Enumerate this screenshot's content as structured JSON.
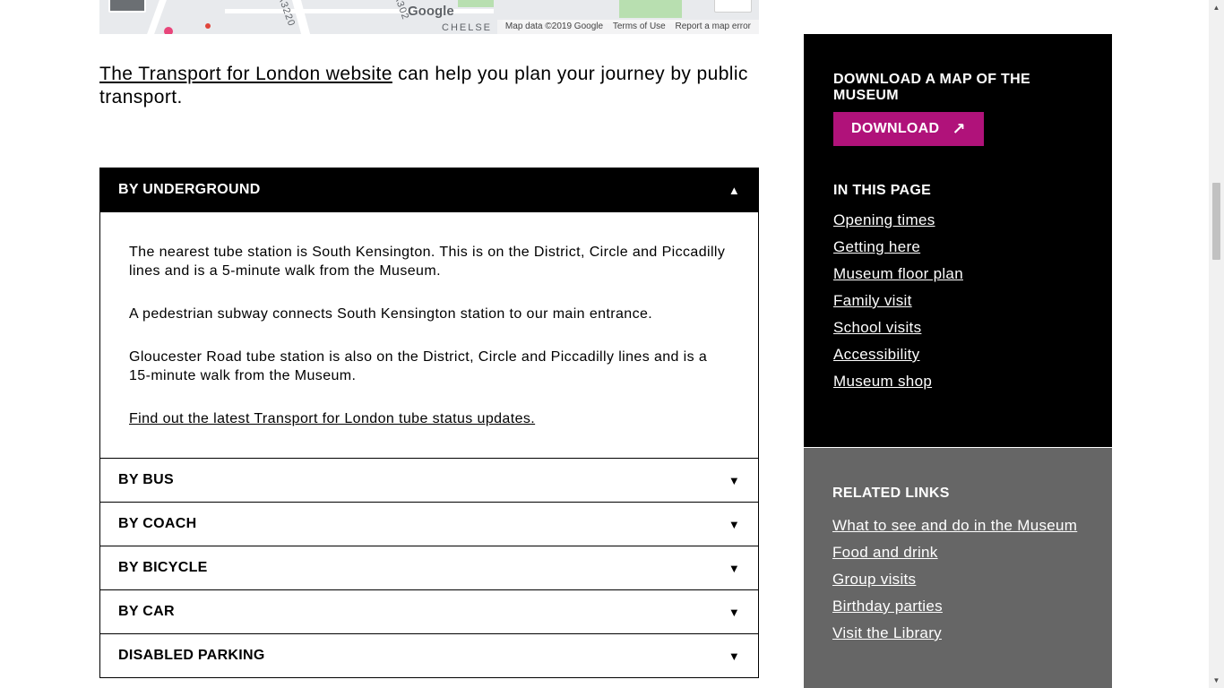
{
  "map": {
    "labels": [
      "Google",
      "CHELSE",
      "A3220",
      "A302"
    ],
    "attribution": [
      "Map data ©2019 Google",
      "Terms of Use",
      "Report a map error"
    ]
  },
  "intro": {
    "link_text": "The Transport for London website",
    "rest_text": " can help you plan your journey by public transport."
  },
  "accordion": {
    "open_section": {
      "title": "BY UNDERGROUND",
      "paragraphs": [
        "The nearest tube station is South Kensington. This is on the District, Circle and Piccadilly lines and is a 5-minute walk from the Museum.",
        "A pedestrian subway connects South Kensington station to our main entrance.",
        "Gloucester Road tube station is also on the District, Circle and Piccadilly lines and is a 15-minute walk from the Museum."
      ],
      "link": "Find out the latest Transport for London tube status updates."
    },
    "sections": [
      "BY BUS",
      "BY COACH",
      "BY BICYCLE",
      "BY CAR",
      "DISABLED PARKING"
    ],
    "icon_open": "▲",
    "icon_closed": "▼"
  },
  "sidebar": {
    "download_heading": "DOWNLOAD A MAP OF THE MUSEUM",
    "download_button": "DOWNLOAD",
    "download_arrow": "↗",
    "in_page_heading": "IN THIS PAGE",
    "in_page_links": [
      "Opening times",
      "Getting here",
      "Museum floor plan",
      "Family visit",
      "School visits",
      "Accessibility",
      "Museum shop"
    ],
    "related_heading": "RELATED LINKS",
    "related_links": [
      "What to see and do in the Museum",
      "Food and drink",
      "Group visits",
      "Birthday parties",
      "Visit the Library"
    ]
  },
  "colors": {
    "accent": "#b0127a",
    "sidebar_dark": "#000000",
    "sidebar_grey": "#666666"
  }
}
